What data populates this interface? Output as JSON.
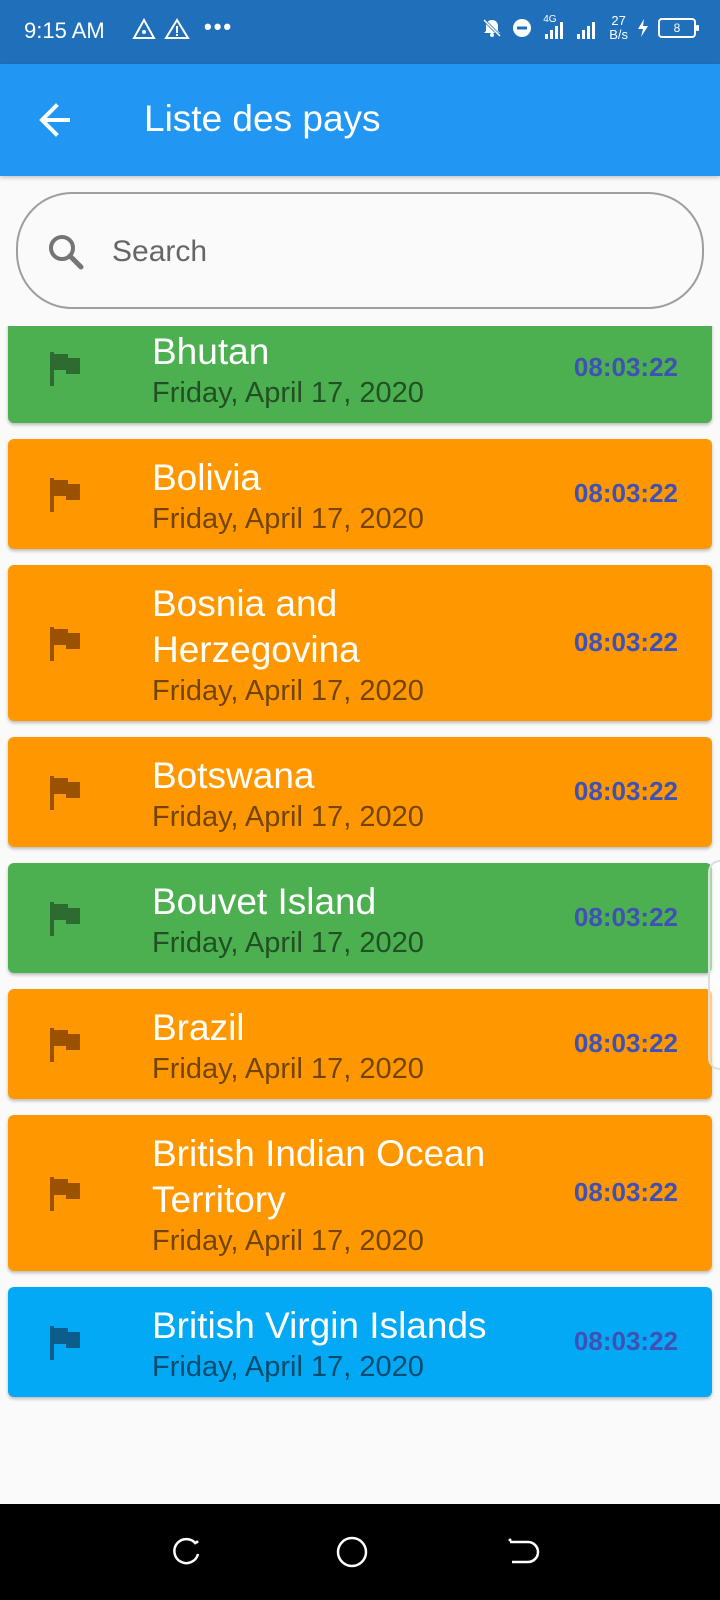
{
  "status_bar": {
    "time": "9:15 AM",
    "network": "4G",
    "speed_value": "27",
    "speed_unit": "B/s",
    "battery": "8",
    "left_icons": [
      "triangle-icon",
      "warning-icon"
    ],
    "right_icons": [
      "bell-off-icon",
      "do-not-disturb-icon",
      "signal-icon",
      "signal-icon",
      "charging-icon",
      "battery-icon"
    ]
  },
  "app_bar": {
    "title": "Liste des pays",
    "back_icon": "arrow-left-icon"
  },
  "search": {
    "placeholder": "Search",
    "value": "",
    "icon": "search-icon"
  },
  "countries": [
    {
      "name": "Bhutan",
      "date": "Friday, April 17, 2020",
      "time": "08:03:22",
      "color": "green"
    },
    {
      "name": "Bolivia",
      "date": "Friday, April 17, 2020",
      "time": "08:03:22",
      "color": "orange"
    },
    {
      "name": "Bosnia and Herzegovina",
      "date": "Friday, April 17, 2020",
      "time": "08:03:22",
      "color": "orange"
    },
    {
      "name": "Botswana",
      "date": "Friday, April 17, 2020",
      "time": "08:03:22",
      "color": "orange"
    },
    {
      "name": "Bouvet Island",
      "date": "Friday, April 17, 2020",
      "time": "08:03:22",
      "color": "green"
    },
    {
      "name": "Brazil",
      "date": "Friday, April 17, 2020",
      "time": "08:03:22",
      "color": "orange"
    },
    {
      "name": "British Indian Ocean Territory",
      "date": "Friday, April 17, 2020",
      "time": "08:03:22",
      "color": "orange"
    },
    {
      "name": "British Virgin Islands",
      "date": "Friday, April 17, 2020",
      "time": "08:03:22",
      "color": "blue"
    }
  ],
  "colors": {
    "app_bar": "#2196f3",
    "status_bar": "#1f6fba",
    "green": "#4caf50",
    "orange": "#ff9800",
    "blue": "#03a9f4",
    "time_text": "#3f51b5"
  },
  "nav_bar": {
    "buttons": [
      "recent-apps-icon",
      "home-icon",
      "back-icon"
    ]
  }
}
